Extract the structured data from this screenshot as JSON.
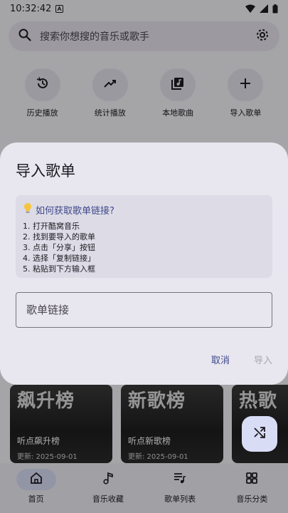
{
  "status_bar": {
    "time": "10:32:42",
    "icons": [
      "notification-a-icon",
      "wifi-icon",
      "signal-icon",
      "battery-icon"
    ]
  },
  "search": {
    "placeholder": "搜索你想搜的音乐或歌手"
  },
  "quick_actions": [
    {
      "label": "历史播放",
      "icon": "history-icon"
    },
    {
      "label": "统计播放",
      "icon": "trending-icon"
    },
    {
      "label": "本地歌曲",
      "icon": "library-music-icon"
    },
    {
      "label": "导入歌单",
      "icon": "plus-icon"
    }
  ],
  "chart_cards": [
    {
      "big_text": "飙升榜",
      "title": "听点飙升榜",
      "date": "更新: 2025-09-01"
    },
    {
      "big_text": "新歌榜",
      "title": "听点新歌榜",
      "date": "更新: 2025-09-01"
    },
    {
      "big_text": "热歌",
      "title": "",
      "date": ""
    }
  ],
  "bottom_nav": [
    {
      "label": "首页",
      "icon": "home-icon",
      "active": true
    },
    {
      "label": "音乐收藏",
      "icon": "music-note-icon",
      "active": false
    },
    {
      "label": "歌单列表",
      "icon": "playlist-icon",
      "active": false
    },
    {
      "label": "音乐分类",
      "icon": "grid-icon",
      "active": false
    }
  ],
  "dialog": {
    "title": "导入歌单",
    "help_title": "如何获取歌单链接?",
    "steps": [
      "1. 打开酷窝音乐",
      "2. 找到要导入的歌单",
      "3. 点击「分享」按钮",
      "4. 选择「复制链接」",
      "5. 粘贴到下方输入框"
    ],
    "input_placeholder": "歌单链接",
    "cancel_label": "取消",
    "import_label": "导入"
  },
  "colors": {
    "accent": "#3f4a8a",
    "surface": "#e8e6ef",
    "disabled": "#a9a7b0"
  }
}
